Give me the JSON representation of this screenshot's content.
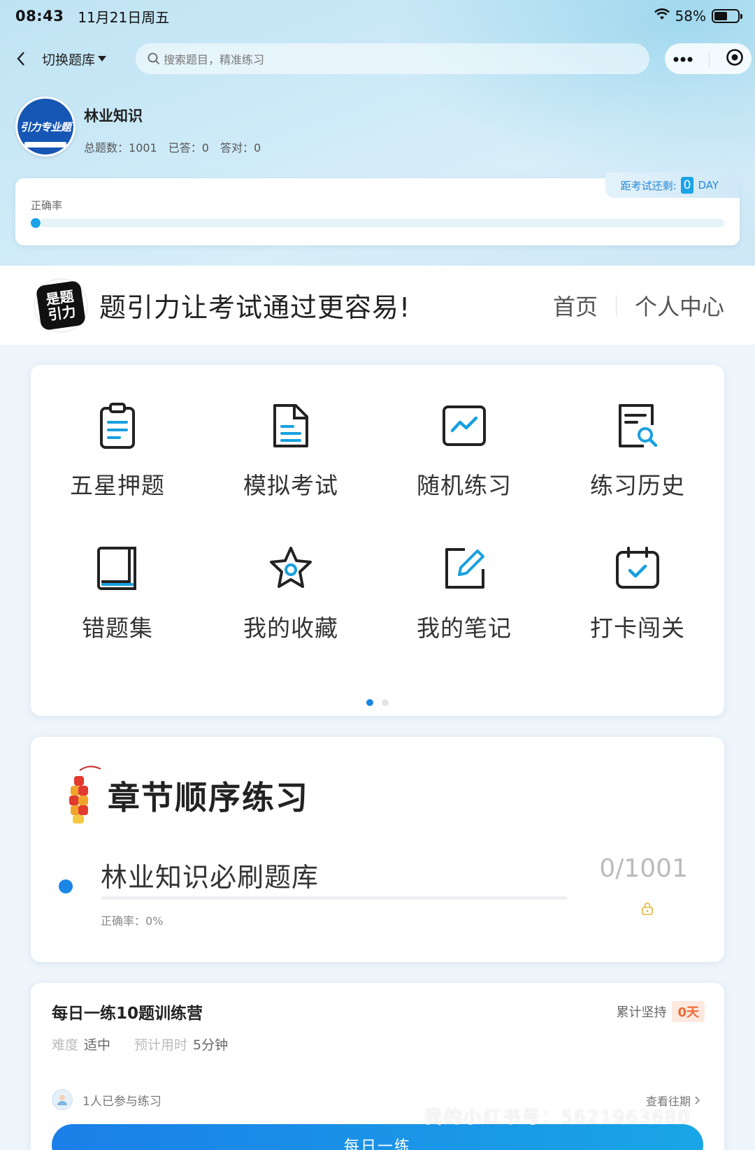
{
  "status_bar": {
    "time": "08:43",
    "date": "11月21日周五",
    "battery": "58%"
  },
  "nav": {
    "switch_bank": "切换题库",
    "search_placeholder": "搜索题目，精准练习"
  },
  "profile": {
    "avatar_text": "引力专业题",
    "name": "林业知识",
    "total_label": "总题数：",
    "total_value": "1001",
    "answered_label": "已答：",
    "answered_value": "0",
    "correct_label": "答对：",
    "correct_value": "0"
  },
  "accuracy": {
    "label": "正确率",
    "value_fraction": 0
  },
  "exam_countdown": {
    "label": "距考试还剩:",
    "value": "0",
    "unit": "DAY"
  },
  "slogan": {
    "logo_line1": "是题",
    "logo_line2": "引力",
    "text": "题引力让考试通过更容易!",
    "nav_home": "首页",
    "nav_profile": "个人中心"
  },
  "features": [
    {
      "label": "五星押题",
      "icon": "clipboard-icon"
    },
    {
      "label": "模拟考试",
      "icon": "document-icon"
    },
    {
      "label": "随机练习",
      "icon": "chart-line-icon"
    },
    {
      "label": "练习历史",
      "icon": "history-search-icon"
    },
    {
      "label": "错题集",
      "icon": "book-icon"
    },
    {
      "label": "我的收藏",
      "icon": "star-icon"
    },
    {
      "label": "我的笔记",
      "icon": "note-edit-icon"
    },
    {
      "label": "打卡闯关",
      "icon": "calendar-check-icon"
    }
  ],
  "pager": {
    "pages": 2,
    "active": 0
  },
  "chapter": {
    "title": "章节顺序练习",
    "item_name": "林业知识必刷题库",
    "progress": "0/1001",
    "accuracy_label": "正确率：",
    "accuracy_value": "0%"
  },
  "daily": {
    "title": "每日一练10题训练营",
    "streak_label": "累计坚持",
    "streak_value": "0天",
    "difficulty_label": "难度",
    "difficulty_value": "适中",
    "time_label": "预计用时",
    "time_value": "5分钟",
    "participants": "1人已参与练习",
    "history_link": "查看往期",
    "button": "每日一练"
  },
  "watermark": "我的小红书号：5621963680",
  "colors": {
    "accent": "#1a86e6",
    "accent_light": "#1aa3e8",
    "streak": "#ef6a35",
    "lock": "#e0b53a"
  }
}
